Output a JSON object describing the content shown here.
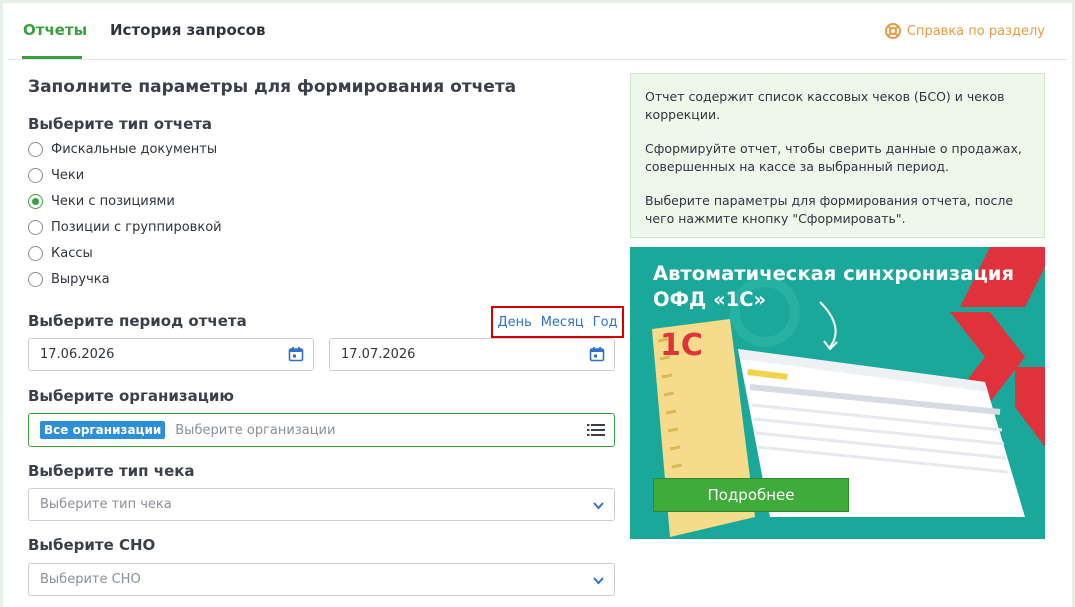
{
  "tabs": [
    {
      "label": "Отчеты",
      "active": true
    },
    {
      "label": "История запросов",
      "active": false
    }
  ],
  "help_link": "Справка по разделу",
  "form": {
    "title": "Заполните параметры для формирования отчета",
    "report_type": {
      "label": "Выберите тип отчета",
      "options": [
        {
          "label": "Фискальные документы",
          "checked": false
        },
        {
          "label": "Чеки",
          "checked": false
        },
        {
          "label": "Чеки с позициями",
          "checked": true
        },
        {
          "label": "Позиции с группировкой",
          "checked": false
        },
        {
          "label": "Кассы",
          "checked": false
        },
        {
          "label": "Выручка",
          "checked": false
        }
      ]
    },
    "period": {
      "label": "Выберите период отчета",
      "links": [
        "День",
        "Месяц",
        "Год"
      ],
      "date_from": "17.06.2026",
      "date_to": "17.07.2026"
    },
    "organization": {
      "label": "Выберите организацию",
      "tag": "Все организации",
      "placeholder": "Выберите организации"
    },
    "check_type": {
      "label": "Выберите тип чека",
      "placeholder": "Выберите тип чека"
    },
    "sno": {
      "label": "Выберите СНО",
      "placeholder": "Выберите СНО"
    }
  },
  "info": {
    "paragraphs": [
      "Отчет содержит список кассовых чеков (БСО) и чеков коррекции.",
      "Сформируйте отчет, чтобы сверить данные о продажах, совершенных на кассе за выбранный период.",
      "Выберите параметры для формирования отчета, после чего нажмите кнопку \"Сформировать\"."
    ]
  },
  "banner": {
    "title_line1": "Автоматическая синхронизация",
    "title_line2": "ОФД «1С»",
    "logo": "1С",
    "button": "Подробнее"
  },
  "colors": {
    "accent_green": "#3aa03f",
    "link_blue": "#2e72c9",
    "help_orange": "#e79a43",
    "tag_blue": "#2e8fd8",
    "banner_teal": "#1aa89a",
    "highlight_red": "#d40000"
  },
  "icons": [
    "lifebuoy-icon",
    "calendar-icon",
    "list-icon",
    "chevron-down-icon"
  ]
}
